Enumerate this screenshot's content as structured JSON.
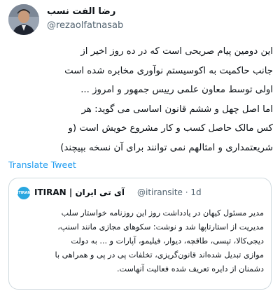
{
  "author": {
    "display_name": "رضا الفت نسب",
    "handle": "@rezaolfatnasab"
  },
  "tweet": {
    "lines": [
      "این دومین پیام صریحی است که در ده روز اخیر از",
      "جانب حاکمیت به اکوسیستم نوآوری مخابره شده است",
      "اولی توسط معاون علمی رییس جمهور و امروز ...",
      "اما اصل چهل و ششم قانون اساسی می گوید: هر",
      "کس مالک حاصل کسب و کار مشروع خویش است (و",
      "شریعتمداری و امثالهم نمی توانند برای آن نسخه بپیچند)"
    ]
  },
  "translate_label": "Translate Tweet",
  "quoted_tweet": {
    "logo_text": "ITIRAN",
    "name": "ITIRAN | آی تی ایران",
    "handle_time": "@itiransite · 1d",
    "lines": [
      "مدیر مسئول کیهان در یادداشت روز این روزنامه خواستار سلب",
      "مدیریت از استارتاپها شد و نوشت:  سکوهای مجازی مانند اسنپ،",
      "دیجی‌کالا، تپسی، طاقچه، دیوار، فیلیمو، آپارات و ... به دولت",
      "موازی تبدیل شده‌اند قانون‌گریزی، تخلفات پی در پی و همراهی با",
      "دشمنان از دایره تعریف شده فعالیت آنهاست."
    ]
  }
}
